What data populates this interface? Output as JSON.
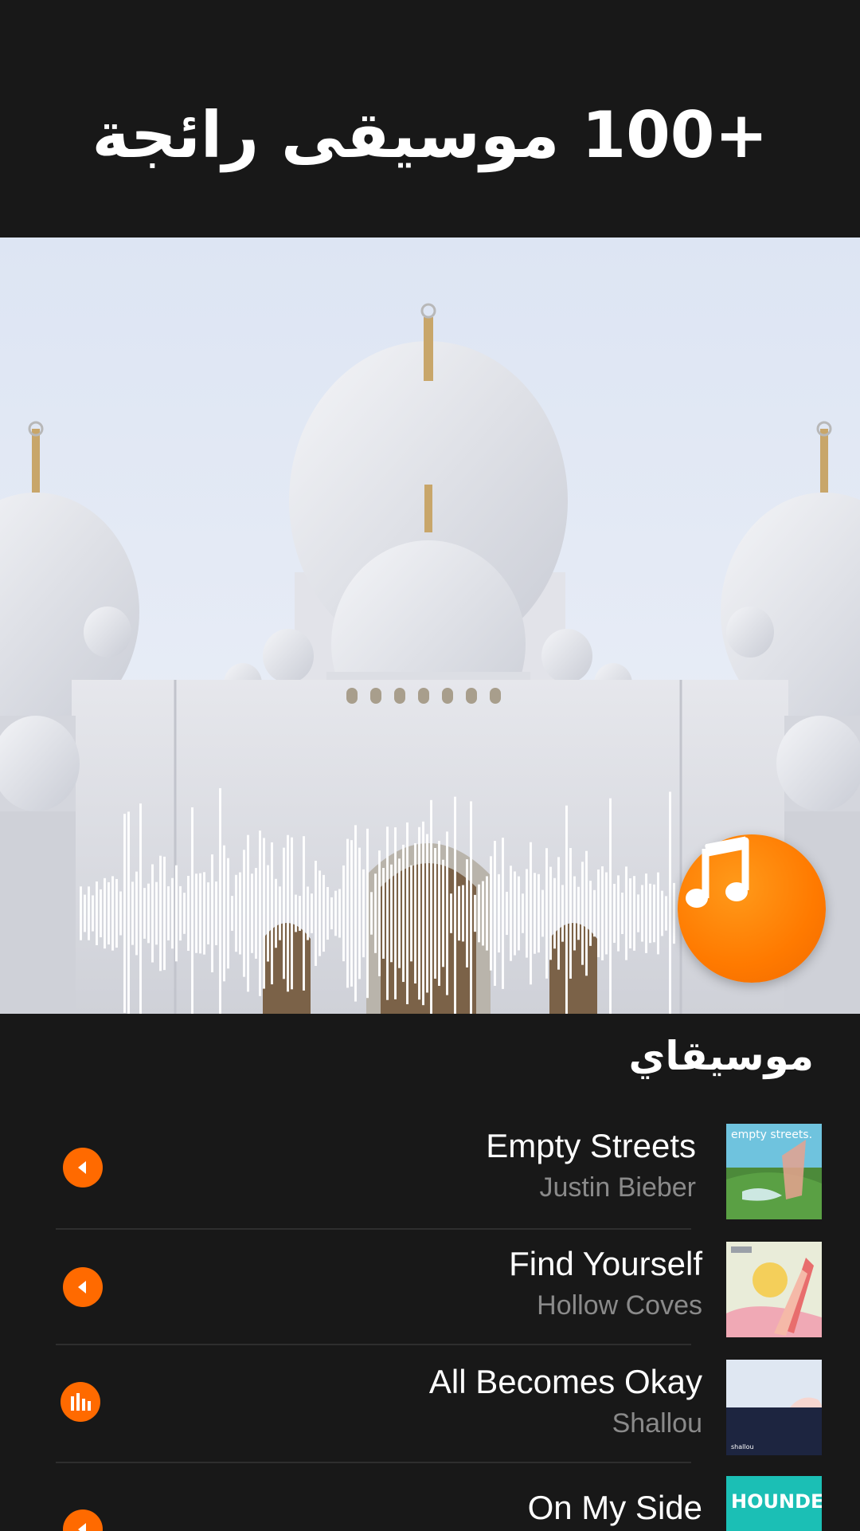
{
  "headline": "+100 موسيقى رائجة",
  "section_title": "موسيقاي",
  "tracks": [
    {
      "title": "Empty Streets",
      "artist": "Justin Bieber",
      "state": "play",
      "cover_text": "empty streets."
    },
    {
      "title": "Find Yourself",
      "artist": "Hollow  Coves",
      "state": "play",
      "cover_text": ""
    },
    {
      "title": "All Becomes Okay",
      "artist": "Shallou",
      "state": "playing",
      "cover_text": "shallou"
    },
    {
      "title": "On My Side",
      "artist": "",
      "state": "play",
      "cover_text": "HOUNDED"
    }
  ],
  "icons": {
    "fab": "music-note-icon",
    "play": "play-icon",
    "equalizer": "equalizer-icon"
  },
  "colors": {
    "background": "#181818",
    "accent": "#ff6a00",
    "text": "#ffffff",
    "subtext": "#8a8a8a"
  }
}
